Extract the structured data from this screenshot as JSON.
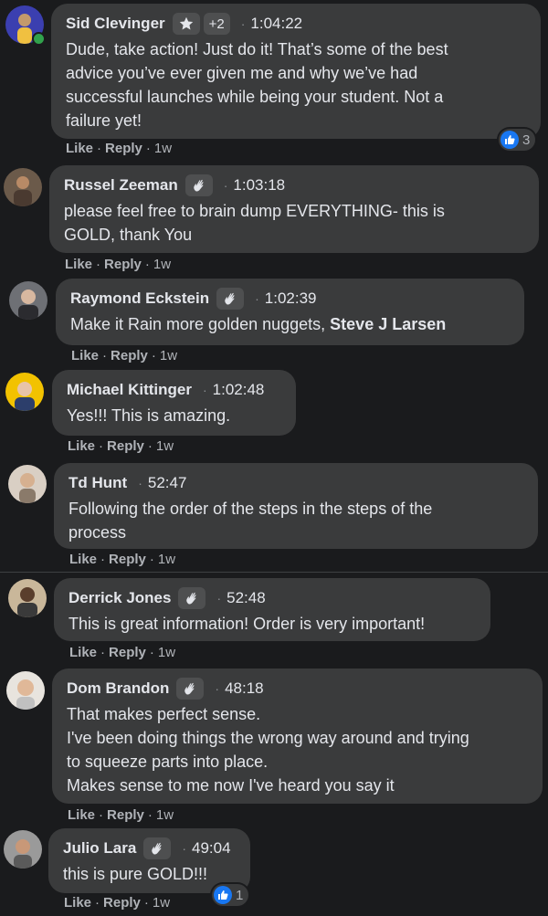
{
  "comments": [
    {
      "name": "Sid Clevinger",
      "time": "1:04:22",
      "plus": "+2",
      "text": "Dude, take action! Just do it! That’s some of the best\nadvice you’ve ever given me and why we’ve had\nsuccessful launches while being your student. Not a\nfailure yet!",
      "like": "Like",
      "reply": "Reply",
      "ago": "1w",
      "reactions": "3",
      "avatar_color": "#3b3fb0",
      "badge_icon": "star-icon"
    },
    {
      "name": "Russel Zeeman",
      "time": "1:03:18",
      "text": "please feel free to brain dump EVERYTHING- this is\nGOLD, thank You",
      "like": "Like",
      "reply": "Reply",
      "ago": "1w",
      "avatar_color": "#6b5a4a",
      "badge_icon": "wave-icon"
    },
    {
      "name": "Raymond Eckstein",
      "time": "1:02:39",
      "text_before": "Make it Rain more golden nuggets, ",
      "text_bold": "Steve J Larsen",
      "like": "Like",
      "reply": "Reply",
      "ago": "1w",
      "avatar_color": "#6e7075",
      "badge_icon": "wave-icon"
    },
    {
      "name": "Michael Kittinger",
      "time": "1:02:48",
      "text": "Yes!!! This is amazing.",
      "like": "Like",
      "reply": "Reply",
      "ago": "1w",
      "avatar_color": "#f2c200"
    },
    {
      "name": "Td Hunt",
      "time": "52:47",
      "text": "Following the order of the steps in the steps of the\nprocess",
      "like": "Like",
      "reply": "Reply",
      "ago": "1w",
      "avatar_color": "#d9cfc4"
    },
    {
      "name": "Derrick Jones",
      "time": "52:48",
      "text": "This is great information! Order is very important!",
      "like": "Like",
      "reply": "Reply",
      "ago": "1w",
      "avatar_color": "#c9b79a",
      "badge_icon": "wave-icon"
    },
    {
      "name": "Dom Brandon",
      "time": "48:18",
      "text": "That makes perfect sense.\nI've been doing things the wrong way around and trying\nto squeeze parts into place.\nMakes sense to me now I've heard you say it",
      "like": "Like",
      "reply": "Reply",
      "ago": "1w",
      "avatar_color": "#e8e4de",
      "badge_icon": "wave-icon"
    },
    {
      "name": "Julio Lara",
      "time": "49:04",
      "text": "this is pure GOLD!!!",
      "like": "Like",
      "reply": "Reply",
      "ago": "1w",
      "reactions": "1",
      "avatar_color": "#9a9a9a",
      "badge_icon": "wave-icon"
    }
  ],
  "colors": {
    "background": "#1a1b1d",
    "bubble": "#3a3b3c",
    "text": "#e4e6eb",
    "muted": "#b0b3b8",
    "like_blue": "#1877f2"
  }
}
